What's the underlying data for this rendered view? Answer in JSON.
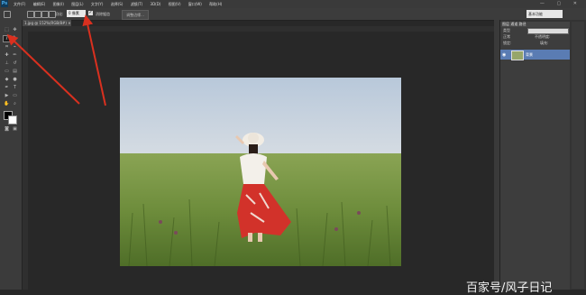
{
  "app": {
    "logo": "Ps"
  },
  "menu": [
    "文件(F)",
    "编辑(E)",
    "图像(I)",
    "图层(L)",
    "文字(Y)",
    "选择(S)",
    "滤镜(T)",
    "3D(D)",
    "视图(V)",
    "窗口(W)",
    "帮助(H)"
  ],
  "window_controls": "— ▢ ✕",
  "options": {
    "feather_label": "羽化:",
    "feather_value": "0 像素",
    "antialias_label": "消除锯齿",
    "antialias_checked": "✓",
    "refine_edge_label": "调整边缘...",
    "workspace": "基本功能"
  },
  "document": {
    "tab_label": "1.jpg @ 152%(RGB/8#) ✕"
  },
  "layers_panel": {
    "tabs": "图层  通道  路径",
    "kind_label": "类型",
    "blend_mode": "正常",
    "opacity_label": "不透明度:",
    "lock_label": "锁定:",
    "fill_label": "填充:",
    "layer_name": "背景"
  },
  "watermark": "百家号/风子日记",
  "icons": {
    "lasso": "lasso-icon",
    "eye": "eye-icon"
  },
  "colors": {
    "accent_arrow": "#d9301f",
    "layer_selected": "#5a7cb3"
  }
}
